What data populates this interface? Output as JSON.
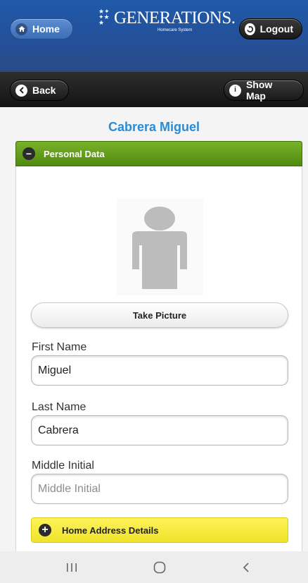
{
  "header": {
    "home_label": "Home",
    "logout_label": "Logout",
    "logo_text": "GENERATIONS.",
    "logo_subtext": "Homecare System"
  },
  "toolbar": {
    "back_label": "Back",
    "show_map_label": "Show Map"
  },
  "page": {
    "title": "Cabrera Miguel"
  },
  "personal_data": {
    "header_label": "Personal Data",
    "take_picture_label": "Take Picture",
    "fields": [
      {
        "label": "First Name",
        "value": "Miguel",
        "placeholder": ""
      },
      {
        "label": "Last Name",
        "value": "Cabrera",
        "placeholder": ""
      },
      {
        "label": "Middle Initial",
        "value": "",
        "placeholder": "Middle Initial"
      }
    ]
  },
  "home_address": {
    "header_label": "Home Address Details"
  },
  "icons": {
    "home": "home-icon",
    "logout": "logout-icon",
    "back": "chevron-left-icon",
    "info": "info-icon",
    "collapse": "minus-icon",
    "expand": "plus-icon",
    "avatar": "person-silhouette-icon"
  },
  "colors": {
    "header_blue": "#24509a",
    "title_blue": "#2a8cd4",
    "section_green": "#5f9a1a",
    "section_yellow": "#f5e93a"
  }
}
